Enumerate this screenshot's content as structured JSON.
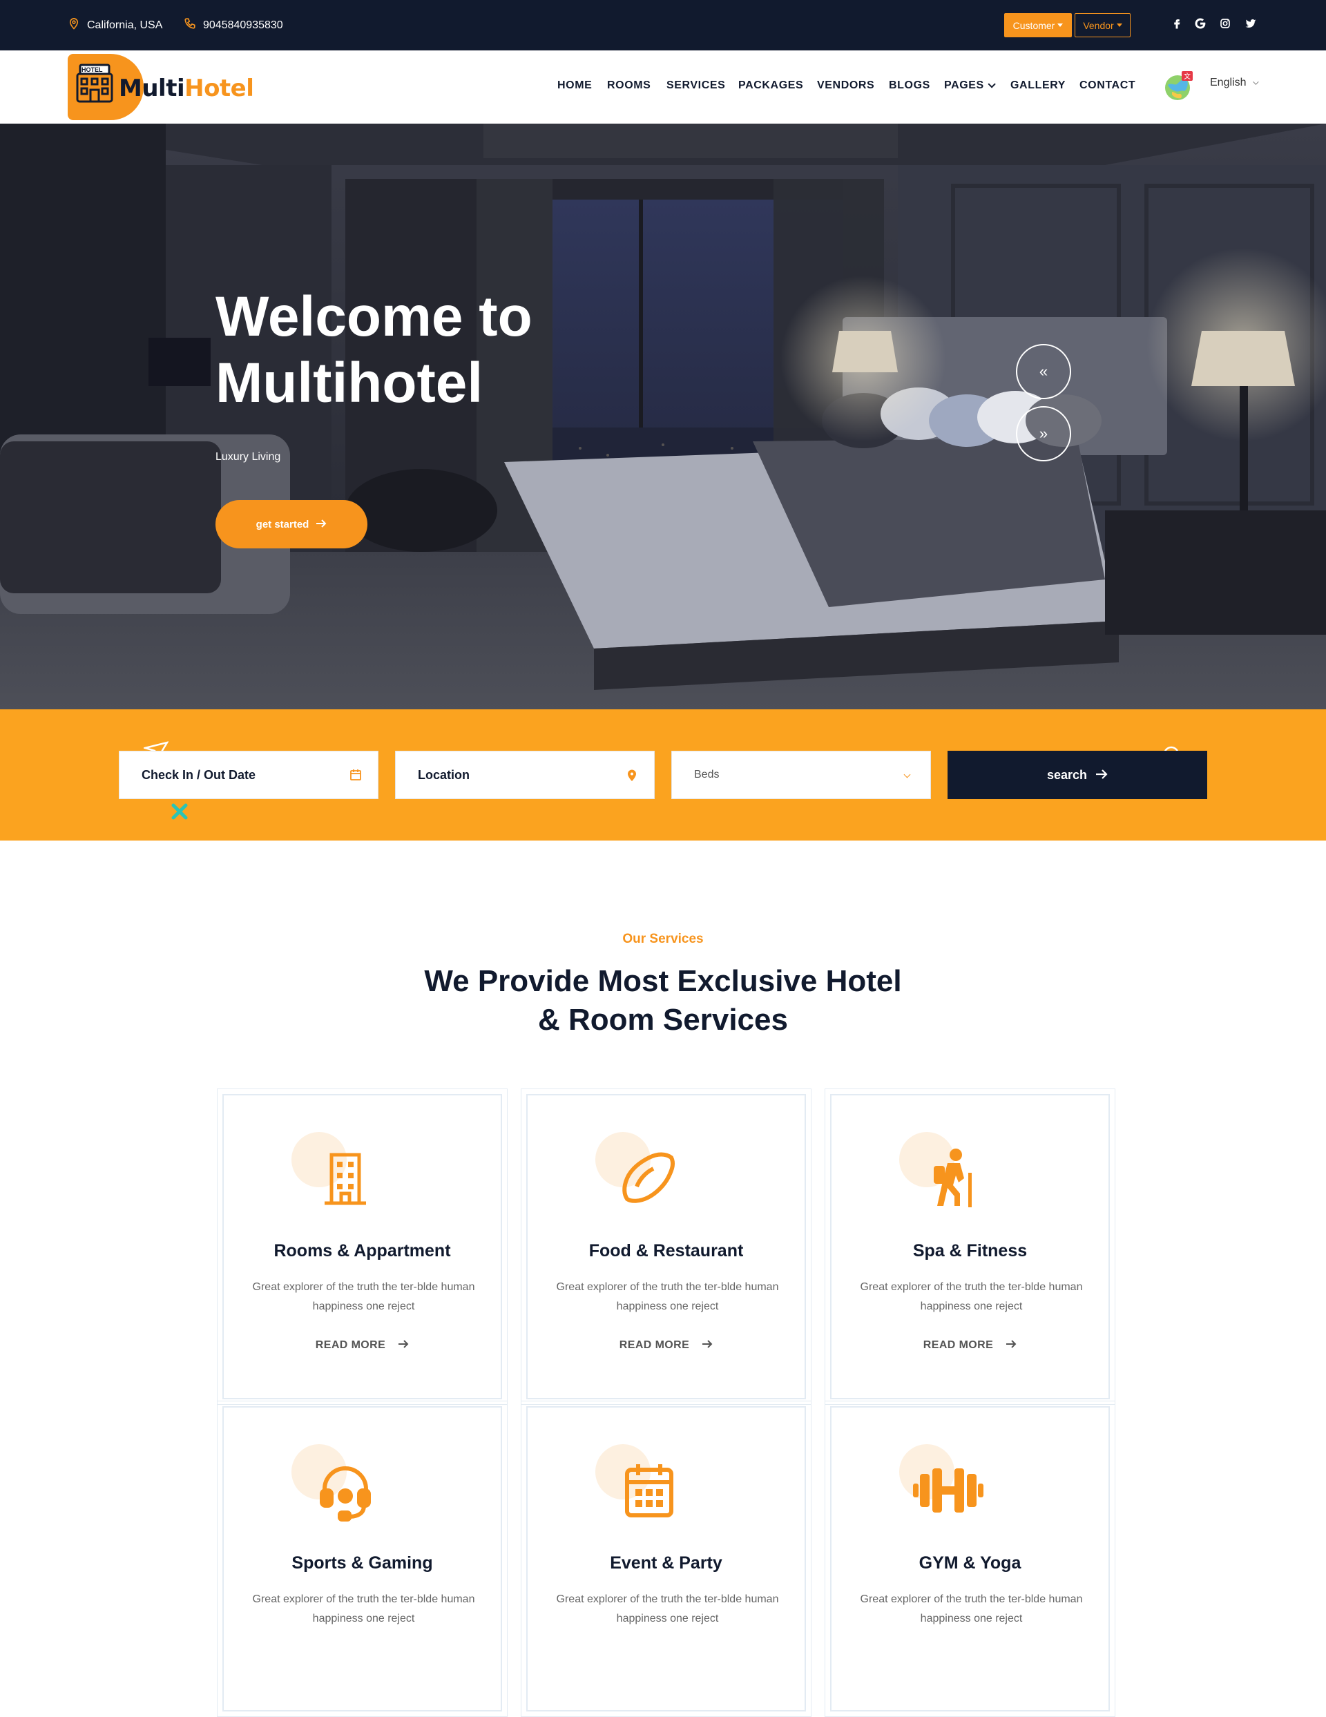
{
  "topbar": {
    "location": "California, USA",
    "phone": "9045840935830",
    "customer_label": "Customer",
    "vendor_label": "Vendor",
    "social_icons": [
      "facebook-icon",
      "google-icon",
      "instagram-icon",
      "twitter-icon"
    ]
  },
  "brand": {
    "badge": "HOTEL",
    "name_part1": "Multi",
    "name_part2": "Hotel"
  },
  "nav": {
    "items": [
      "HOME",
      "ROOMS",
      "SERVICES",
      "PACKAGES",
      "VENDORS",
      "BLOGS",
      "PAGES",
      "GALLERY",
      "CONTACT"
    ],
    "language": "English"
  },
  "hero": {
    "title": "Welcome to Multihotel",
    "subtitle": "Luxury Living",
    "cta": "get started",
    "prev": "«",
    "next": "»"
  },
  "search": {
    "date_label": "Check In / Out Date",
    "location_label": "Location",
    "beds_label": "Beds",
    "button": "search"
  },
  "services": {
    "eyebrow": "Our Services",
    "title": "We Provide Most Exclusive Hotel & Room Services",
    "read_more": "READ MORE",
    "cards": [
      {
        "title": "Rooms & Appartment",
        "desc": "Great explorer of the truth the ter-blde human happiness one reject",
        "icon": "building-icon"
      },
      {
        "title": "Food & Restaurant",
        "desc": "Great explorer of the truth the ter-blde human happiness one reject",
        "icon": "lemon-icon"
      },
      {
        "title": "Spa & Fitness",
        "desc": "Great explorer of the truth the ter-blde human happiness one reject",
        "icon": "hiker-icon"
      },
      {
        "title": "Sports & Gaming",
        "desc": "Great explorer of the truth the ter-blde human happiness one reject",
        "icon": "headset-icon"
      },
      {
        "title": "Event & Party",
        "desc": "Great explorer of the truth the ter-blde human happiness one reject",
        "icon": "calendar-icon"
      },
      {
        "title": "GYM & Yoga",
        "desc": "Great explorer of the truth the ter-blde human happiness one reject",
        "icon": "dumbbell-icon"
      }
    ]
  },
  "colors": {
    "accent": "#f7941d",
    "strip": "#fba31f",
    "dark": "#111a2e"
  }
}
